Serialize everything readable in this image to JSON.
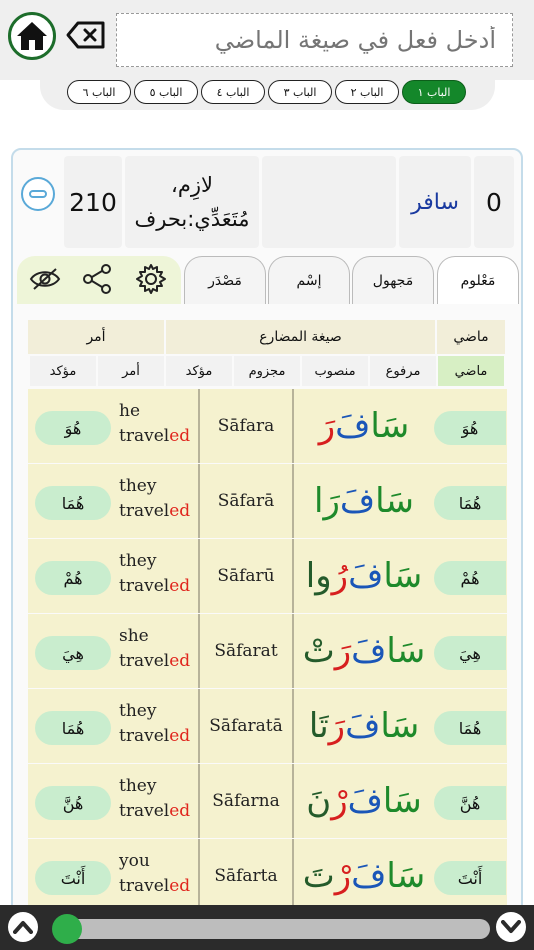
{
  "header": {
    "input_placeholder": "أدخل فعل في صيغة الماضي"
  },
  "babs": [
    "الباب ١",
    "الباب ٢",
    "الباب ٣",
    "الباب ٤",
    "الباب ٥",
    "الباب ٦"
  ],
  "active_bab_index": 0,
  "info": {
    "index": "0",
    "verb": "سافر",
    "type_line1": "لازِم،",
    "type_line2": "مُتَعَدِّي:بحرف",
    "number": "210"
  },
  "modes": [
    "مَعْلوم",
    "مَجهول",
    "إسْم",
    "مَصْدَر"
  ],
  "active_mode_index": 0,
  "table_headers": {
    "past": "ماضي",
    "present": "صيغة المضارع",
    "imperative": "أمر"
  },
  "sub_headers": [
    "ماضي",
    "مرفوع",
    "منصوب",
    "مجزوم",
    "مؤكد",
    "أمر",
    "مؤكد"
  ],
  "rows": [
    {
      "pronoun_ar": "هُوَ",
      "en_subject": "he",
      "en_stem": "travel",
      "en_suffix": "ed",
      "translit": "Sāfara",
      "ar": [
        "سَا",
        "فَ",
        "رَ",
        ""
      ],
      "pronoun_right": "هُوَ"
    },
    {
      "pronoun_ar": "هُمَا",
      "en_subject": "they",
      "en_stem": "travel",
      "en_suffix": "ed",
      "translit": "Sāfarā",
      "ar": [
        "سَا",
        "فَ",
        "رَا",
        ""
      ],
      "pronoun_right": "هُمَا"
    },
    {
      "pronoun_ar": "هُمْ",
      "en_subject": "they",
      "en_stem": "travel",
      "en_suffix": "ed",
      "translit": "Sāfarū",
      "ar": [
        "سَا",
        "فَ",
        "رُ",
        "وا"
      ],
      "pronoun_right": "هُمْ"
    },
    {
      "pronoun_ar": "هِيَ",
      "en_subject": "she",
      "en_stem": "travel",
      "en_suffix": "ed",
      "translit": "Sāfarat",
      "ar": [
        "سَا",
        "فَ",
        "رَ",
        "تْ"
      ],
      "pronoun_right": "هِيَ"
    },
    {
      "pronoun_ar": "هُمَا",
      "en_subject": "they",
      "en_stem": "travel",
      "en_suffix": "ed",
      "translit": "Sāfaratā",
      "ar": [
        "سَا",
        "فَ",
        "رَ",
        "تَا"
      ],
      "pronoun_right": "هُمَا"
    },
    {
      "pronoun_ar": "هُنَّ",
      "en_subject": "they",
      "en_stem": "travel",
      "en_suffix": "ed",
      "translit": "Sāfarna",
      "ar": [
        "سَا",
        "فَ",
        "رْ",
        "نَ"
      ],
      "pronoun_right": "هُنَّ"
    },
    {
      "pronoun_ar": "أَنْتَ",
      "en_subject": "you",
      "en_stem": "travel",
      "en_suffix": "ed",
      "translit": "Sāfarta",
      "ar": [
        "سَا",
        "فَ",
        "رْ",
        "تَ"
      ],
      "pronoun_right": "أَنْتَ"
    }
  ],
  "slider": {
    "position": 0.0
  }
}
